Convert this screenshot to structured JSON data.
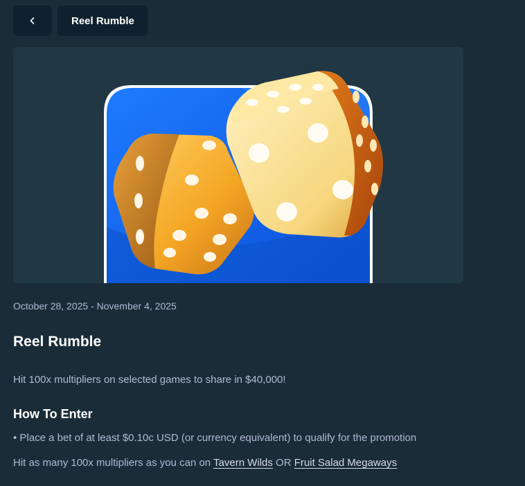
{
  "header": {
    "back_icon": "chevron-left-icon",
    "title": "Reel Rumble"
  },
  "banner": {
    "image": "golden-dice-illustration",
    "colors": {
      "background": "#213743",
      "panel_blue": "#1a6cf0",
      "dice_gold": "#f4b032"
    }
  },
  "promotion": {
    "dates": "October 28, 2025 - November 4, 2025",
    "title": "Reel Rumble",
    "description": "Hit 100x multipliers on selected games to share in $40,000!",
    "how_to_enter": {
      "heading": "How To Enter",
      "bullet": "• Place a bet of at least $0.10c USD (or currency equivalent) to qualify for the promotion",
      "games_prefix": "Hit as many 100x multipliers as you can on ",
      "game_1": "Tavern Wilds",
      "separator": " OR ",
      "game_2": "Fruit Salad Megaways"
    }
  }
}
